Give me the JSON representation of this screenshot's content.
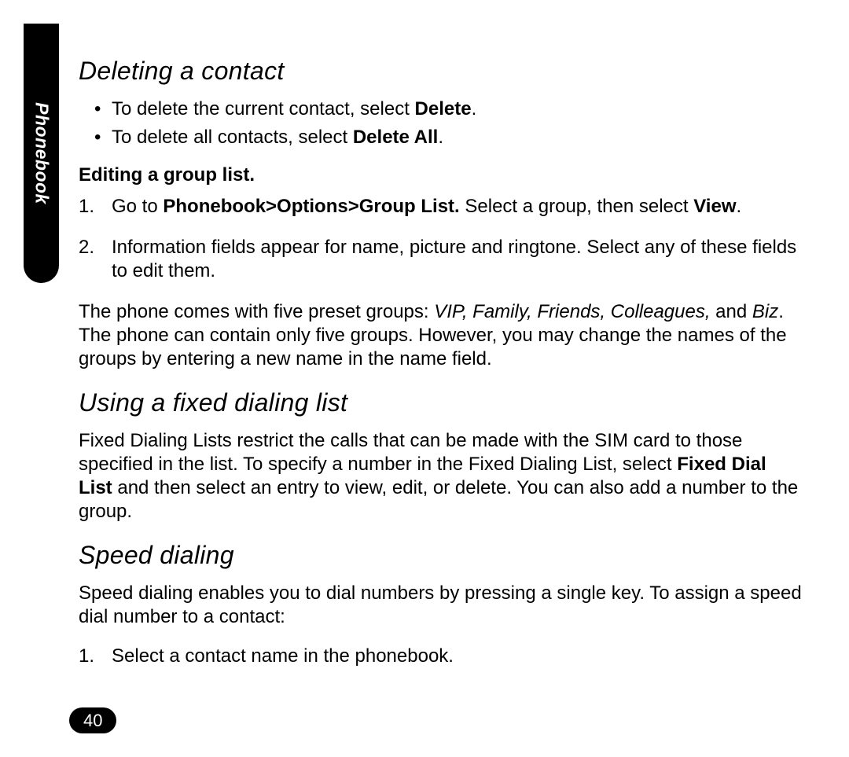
{
  "sideTab": "Phonebook",
  "sec1": {
    "title": "Deleting a contact",
    "bullet1_pre": "To delete the current contact, select ",
    "bullet1_bold": "Delete",
    "bullet1_post": ".",
    "bullet2_pre": "To delete all contacts, select ",
    "bullet2_bold": "Delete All",
    "bullet2_post": ".",
    "sub": "Editing a group list.",
    "step1_pre": "Go to ",
    "step1_bold1": "Phonebook>Options>Group List.",
    "step1_mid": " Select a group, then select ",
    "step1_bold2": "View",
    "step1_post": ".",
    "step2": "Information fields appear for name, picture and ringtone. Select any of these fields to edit them.",
    "para_pre": "The phone comes with five preset groups: ",
    "para_i1": "VIP, Family, Friends, Colleagues,",
    "para_mid": " and ",
    "para_i2": "Biz",
    "para_post": ". The phone can contain only five groups. However, you may change the names of the groups by entering a new name in the name field."
  },
  "sec2": {
    "title": "Using a fixed dialing list",
    "para_pre": "Fixed Dialing Lists restrict the calls that can be made with the SIM card to those specified in the list. To specify a number in the Fixed Dialing List, select ",
    "para_bold": "Fixed Dial List",
    "para_post": " and then select an entry to view, edit, or delete. You can also add a number to the group."
  },
  "sec3": {
    "title": "Speed dialing",
    "intro": "Speed dialing enables you to dial numbers by pressing a single key. To assign a speed dial number to a contact:",
    "step1": "Select a contact name in the phonebook."
  },
  "pageNumber": "40"
}
